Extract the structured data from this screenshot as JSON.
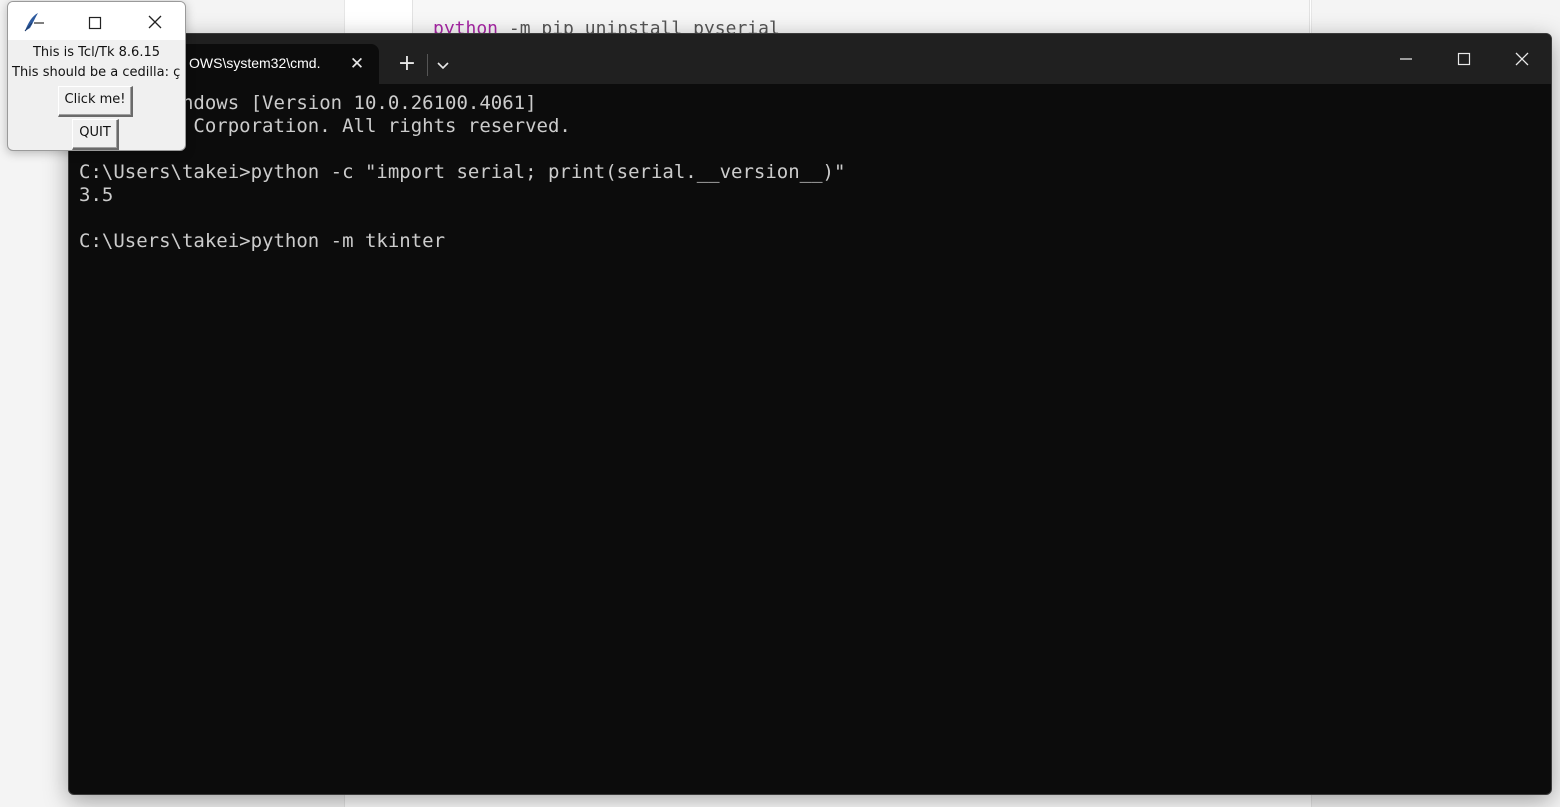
{
  "background": {
    "code_line_prefix": "python",
    "code_line_rest": " -m pip uninstall pyserial"
  },
  "terminal": {
    "tab_title": "OWS\\system32\\cmd.",
    "lines": [
      "       Windows [Version 10.0.26100.4061]",
      "     soft Corporation. All rights reserved.",
      "",
      "C:\\Users\\takei>python -c \"import serial; print(serial.__version__)\"",
      "3.5",
      "",
      "C:\\Users\\takei>python -m tkinter"
    ],
    "icons": {
      "tab_close": "close-icon",
      "new_tab": "plus-icon",
      "dropdown": "chevron-down-icon",
      "minimize": "minimize-icon",
      "maximize": "maximize-icon",
      "close": "close-icon"
    },
    "colors": {
      "background": "#0c0c0c",
      "titlebar": "#202020",
      "text": "#cccccc"
    }
  },
  "tk_window": {
    "line1": "This is Tcl/Tk 8.6.15",
    "line2": "This should be a cedilla: ç",
    "click_button": "Click me!",
    "quit_button": "QUIT"
  }
}
